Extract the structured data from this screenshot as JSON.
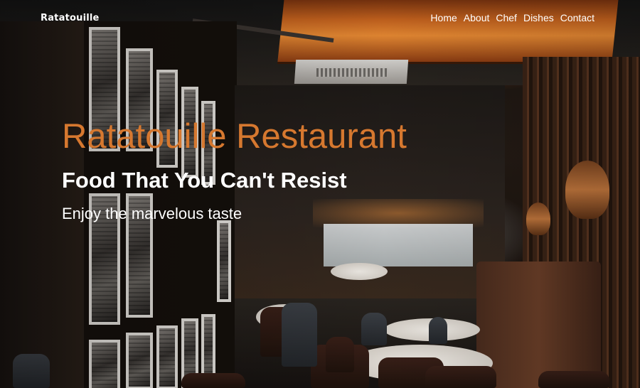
{
  "navbar": {
    "brand": "Ratatouille",
    "links": [
      {
        "label": "Home"
      },
      {
        "label": "About"
      },
      {
        "label": "Chef"
      },
      {
        "label": "Dishes"
      },
      {
        "label": "Contact"
      }
    ]
  },
  "hero": {
    "title": "Ratatouille Restaurant",
    "subtitle": "Food That You Can't Resist",
    "tagline": "Enjoy the marvelous taste"
  },
  "colors": {
    "accent": "#d6782f",
    "text": "#ffffff"
  },
  "background": {
    "image": "restaurant-interior"
  }
}
